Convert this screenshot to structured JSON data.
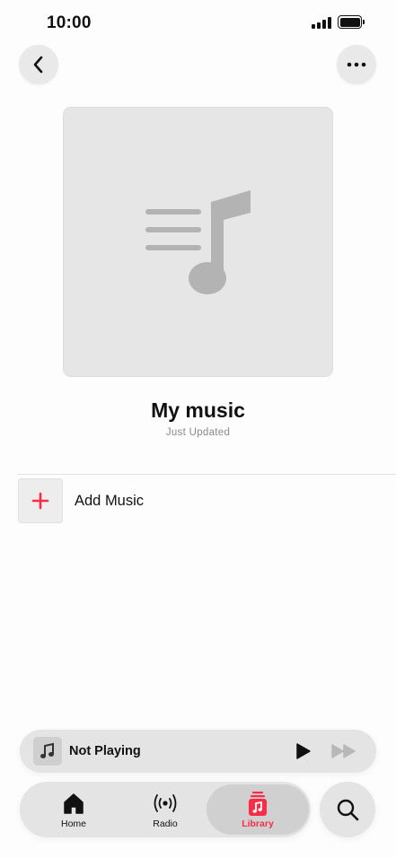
{
  "status_bar": {
    "time": "10:00"
  },
  "header": {
    "back_icon": "chevron-left-icon",
    "more_icon": "ellipsis-icon"
  },
  "playlist": {
    "artwork_icon": "music-note-list-icon",
    "title": "My music",
    "subtitle": "Just Updated"
  },
  "add_music": {
    "label": "Add Music",
    "icon": "plus-icon"
  },
  "mini_player": {
    "title": "Not Playing",
    "play_icon": "play-icon",
    "forward_icon": "fast-forward-icon"
  },
  "tab_bar": {
    "tabs": [
      {
        "label": "Home",
        "icon": "house-icon"
      },
      {
        "label": "Radio",
        "icon": "broadcast-icon"
      },
      {
        "label": "Library",
        "icon": "music-library-icon",
        "selected": true
      }
    ],
    "search_icon": "search-icon"
  },
  "colors": {
    "accent": "#fa2d48",
    "background": "#fdfdfd",
    "control_bg": "#e4e4e4"
  }
}
